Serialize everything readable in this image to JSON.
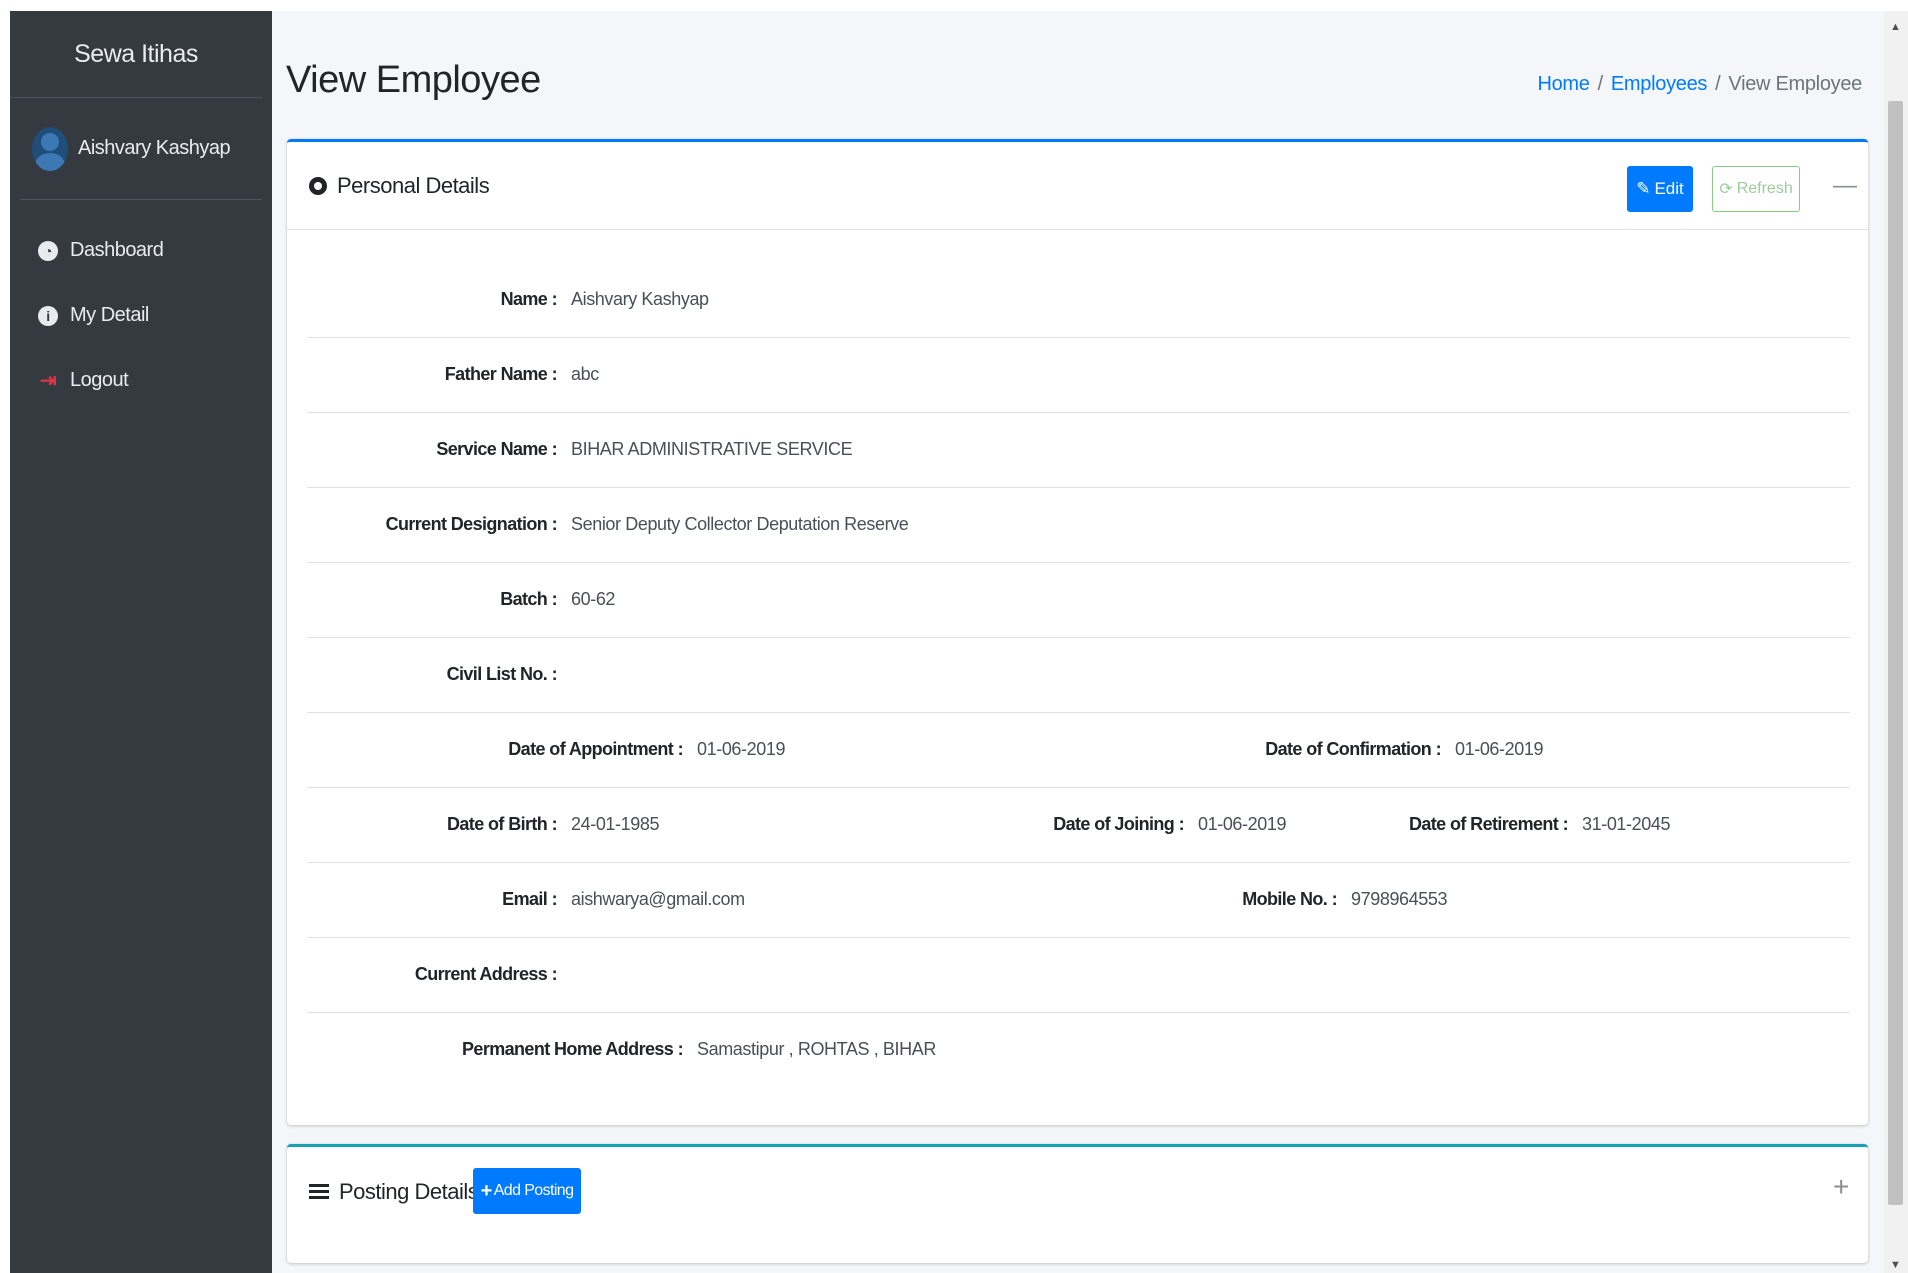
{
  "sidebar": {
    "brand": "Sewa Itihas",
    "user_name": "Aishvary Kashyap",
    "items": [
      {
        "label": "Dashboard",
        "icon": "dashboard-icon"
      },
      {
        "label": "My Detail",
        "icon": "info-icon"
      },
      {
        "label": "Logout",
        "icon": "logout-icon"
      }
    ]
  },
  "header": {
    "title": "View Employee",
    "breadcrumb": [
      "Home",
      "Employees",
      "View Employee"
    ]
  },
  "personal": {
    "title": "Personal Details",
    "edit_label": "Edit",
    "refresh_label": "Refresh",
    "name_label": "Name :",
    "name": "Aishvary Kashyap",
    "father_label": "Father Name :",
    "father": "abc",
    "service_label": "Service Name :",
    "service": "BIHAR ADMINISTRATIVE SERVICE",
    "designation_label": "Current Designation :",
    "designation": "Senior Deputy Collector Deputation Reserve",
    "batch_label": "Batch :",
    "batch": "60-62",
    "civil_label": "Civil List No. :",
    "civil": "",
    "appointment_label": "Date of Appointment :",
    "appointment": "01-06-2019",
    "confirmation_label": "Date of Confirmation :",
    "confirmation": "01-06-2019",
    "dob_label": "Date of Birth :",
    "dob": "24-01-1985",
    "joining_label": "Date of Joining :",
    "joining": "01-06-2019",
    "retirement_label": "Date of Retirement :",
    "retirement": "31-01-2045",
    "email_label": "Email :",
    "email": "aishwarya@gmail.com",
    "mobile_label": "Mobile No. :",
    "mobile": "9798964553",
    "current_address_label": "Current Address :",
    "current_address": "",
    "permanent_address_label": "Permanent Home Address :",
    "permanent_address": "Samastipur , ROHTAS , BIHAR"
  },
  "posting": {
    "title": "Posting Details",
    "add_label": "Add Posting"
  },
  "colors": {
    "sidebar_bg": "#343a40",
    "primary": "#007bff",
    "info": "#17a2b8",
    "success_outline": "#8bc98b",
    "danger": "#dc3545"
  }
}
